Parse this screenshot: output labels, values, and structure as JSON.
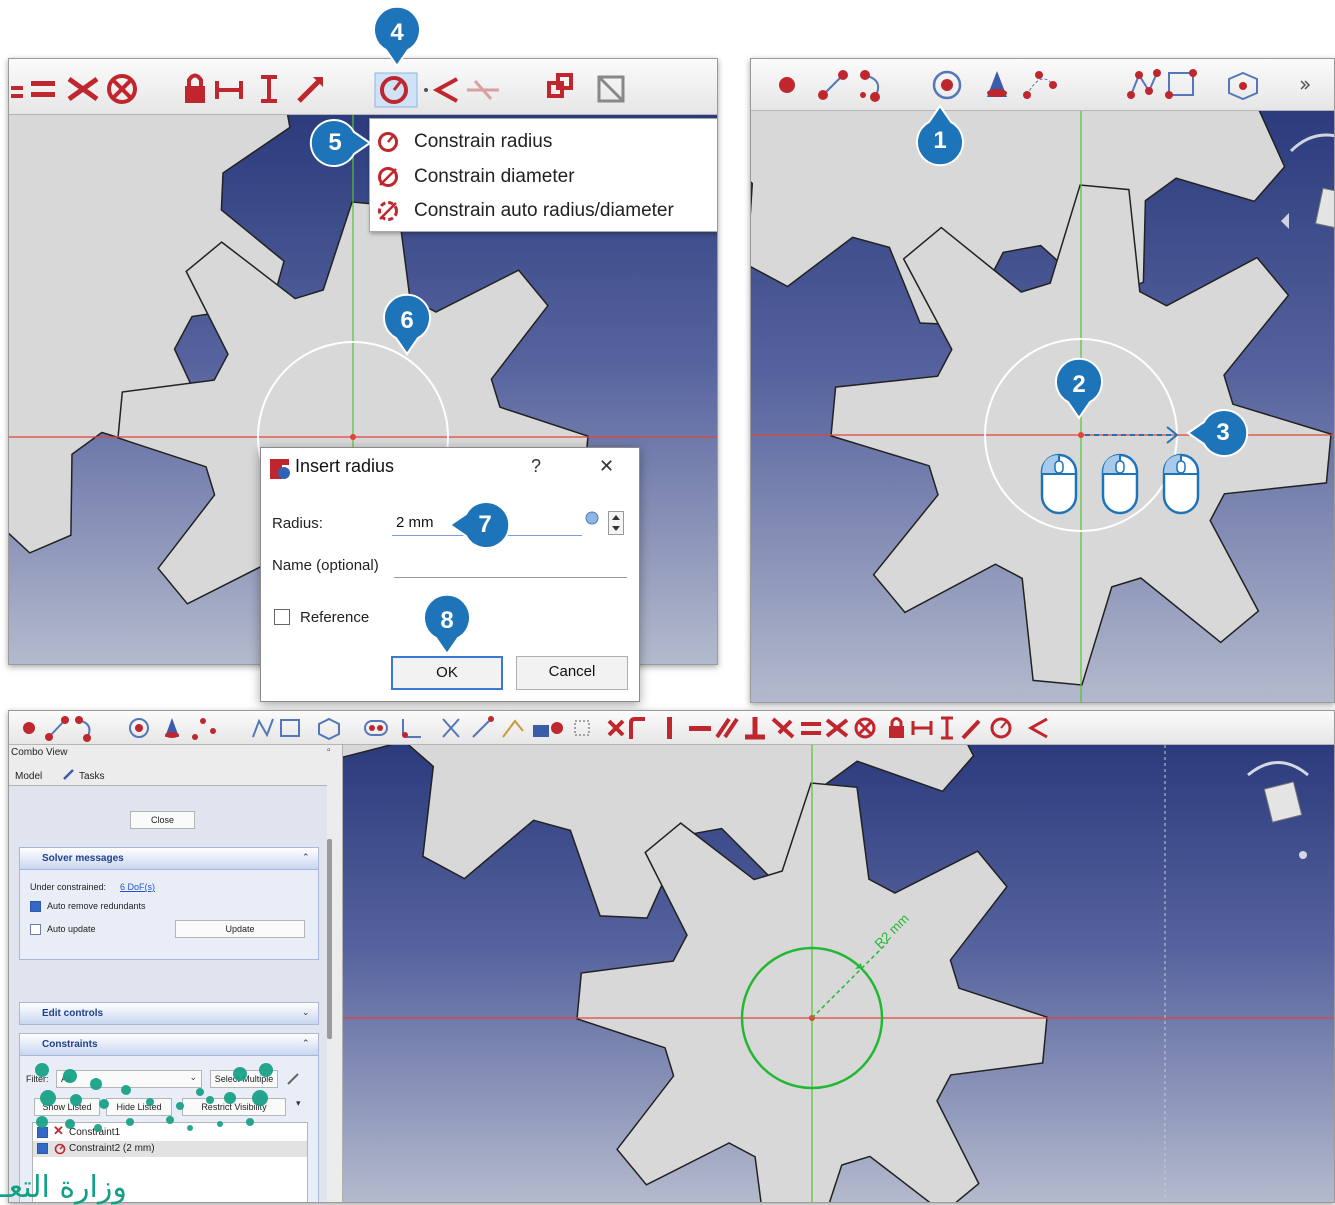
{
  "callouts": [
    "1",
    "2",
    "3",
    "4",
    "5",
    "6",
    "7",
    "8"
  ],
  "colors": {
    "callout_blue": "#1e74b9",
    "constraint_red": "#c0262d",
    "viewport_top": "#2b3b7c",
    "viewport_bottom": "#b4bacd",
    "gear_fill": "#d8d8d8",
    "axis_green": "#58c234",
    "axis_red": "#e0443a",
    "circle_green": "#22b833",
    "ministry_teal": "#14a085"
  },
  "dropdown": {
    "items": [
      {
        "icon": "constrain-radius-icon",
        "label": "Constrain radius"
      },
      {
        "icon": "constrain-diameter-icon",
        "label": "Constrain diameter"
      },
      {
        "icon": "constrain-auto-radius-diameter-icon",
        "label": "Constrain auto radius/diameter"
      }
    ]
  },
  "dialog": {
    "title": "Insert radius",
    "help": "?",
    "close": "✕",
    "radius_label": "Radius:",
    "radius_value": "2 mm",
    "name_label": "Name (optional)",
    "name_value": "",
    "reference_label": "Reference",
    "ok": "OK",
    "cancel": "Cancel"
  },
  "combo_view": {
    "title": "Combo View",
    "tabs": [
      "Model",
      "Tasks"
    ],
    "close_button": "Close",
    "solver_messages": {
      "header": "Solver messages",
      "status_label": "Under constrained:",
      "status_link": "6 DoF(s)",
      "auto_remove": "Auto remove redundants",
      "auto_update": "Auto update",
      "update_button": "Update"
    },
    "edit_controls_header": "Edit controls",
    "constraints": {
      "header": "Constraints",
      "filter_label": "Filter:",
      "filter_value": "All",
      "select_multiple": "Select Multiple",
      "show_listed": "Show Listed",
      "hide_listed": "Hide Listed",
      "restrict_visibility": "Restrict Visibility",
      "list": [
        "Constraint1",
        "Constraint2 (2 mm)"
      ]
    }
  },
  "dimension_label": "R2 mm",
  "watermark": "وزارة التعـ"
}
